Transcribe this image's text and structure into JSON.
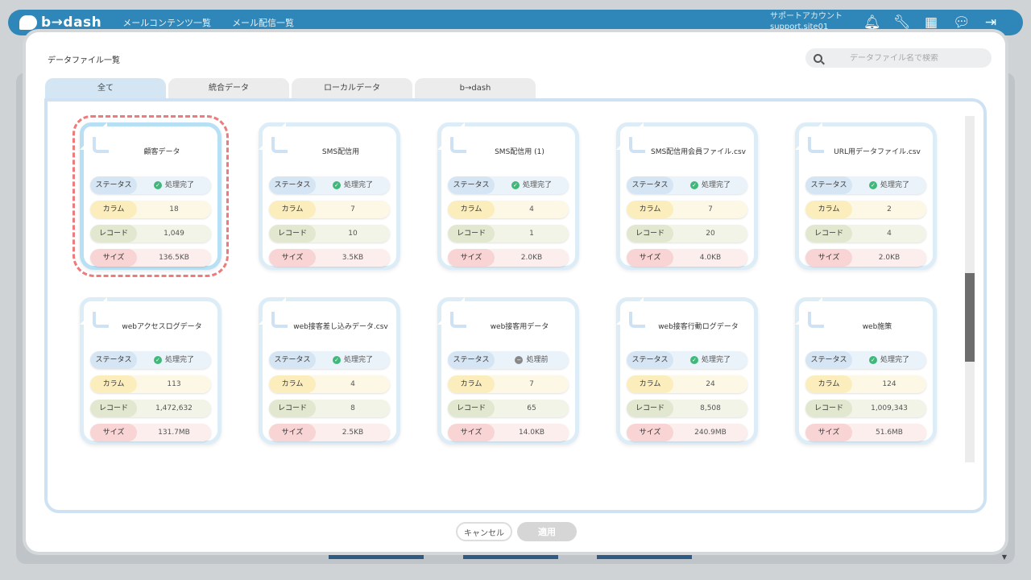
{
  "app": {
    "logo": "b→dash",
    "nav": [
      "メールコンテンツ一覧",
      "メール配信一覧"
    ],
    "account_line1": "サポートアカウント",
    "account_line2": "support.site01"
  },
  "modal": {
    "title": "データファイル一覧",
    "search_placeholder": "データファイル名で検索",
    "tabs": [
      "全て",
      "統合データ",
      "ローカルデータ",
      "b→dash"
    ],
    "active_tab": 0,
    "labels": {
      "status": "ステータス",
      "columns": "カラム",
      "records": "レコード",
      "size": "サイズ"
    },
    "cards": [
      {
        "name": "顧客データ",
        "status": "処理完了",
        "columns": "18",
        "records": "1,049",
        "size": "136.5KB",
        "selected": true
      },
      {
        "name": "SMS配信用",
        "status": "処理完了",
        "columns": "7",
        "records": "10",
        "size": "3.5KB"
      },
      {
        "name": "SMS配信用 (1)",
        "status": "処理完了",
        "columns": "4",
        "records": "1",
        "size": "2.0KB"
      },
      {
        "name": "SMS配信用会員ファイル.csv",
        "status": "処理完了",
        "columns": "7",
        "records": "20",
        "size": "4.0KB"
      },
      {
        "name": "URL用データファイル.csv",
        "status": "処理完了",
        "columns": "2",
        "records": "4",
        "size": "2.0KB"
      },
      {
        "name": "webアクセスログデータ",
        "status": "処理完了",
        "columns": "113",
        "records": "1,472,632",
        "size": "131.7MB"
      },
      {
        "name": "web接客差し込みデータ.csv",
        "status": "処理完了",
        "columns": "4",
        "records": "8",
        "size": "2.5KB"
      },
      {
        "name": "web接客用データ",
        "status": "処理前",
        "columns": "7",
        "records": "65",
        "size": "14.0KB"
      },
      {
        "name": "web接客行動ログデータ",
        "status": "処理完了",
        "columns": "24",
        "records": "8,508",
        "size": "240.9MB"
      },
      {
        "name": "web施策",
        "status": "処理完了",
        "columns": "124",
        "records": "1,009,343",
        "size": "51.6MB"
      }
    ],
    "buttons": {
      "cancel": "キャンセル",
      "apply": "適用"
    }
  }
}
